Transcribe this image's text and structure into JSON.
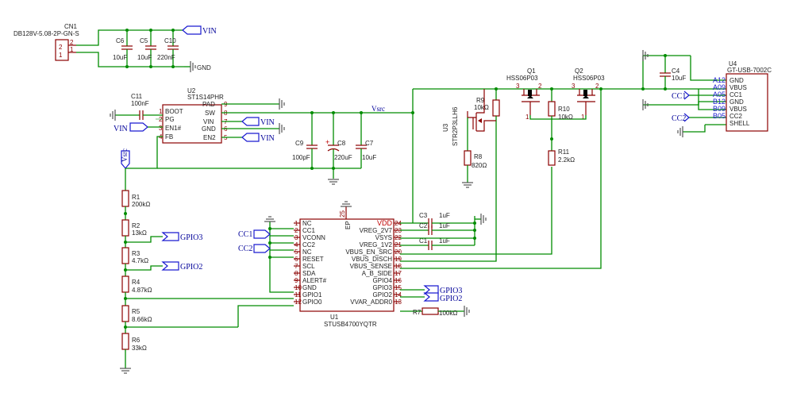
{
  "components": {
    "cn1": {
      "ref": "CN1",
      "value": "DB128V-5.08-2P-GN-S",
      "pins": [
        "2",
        "1"
      ]
    },
    "c6": {
      "ref": "C6",
      "value": "10uF"
    },
    "c5": {
      "ref": "C5",
      "value": "10uF"
    },
    "c10": {
      "ref": "C10",
      "value": "220nF"
    },
    "c11": {
      "ref": "C11",
      "value": "100nF"
    },
    "u2": {
      "ref": "U2",
      "value": "ST1S14PHR",
      "left_pins": [
        {
          "num": "1",
          "name": "BOOT"
        },
        {
          "num": "2",
          "name": "PG"
        },
        {
          "num": "3",
          "name": "EN1#"
        },
        {
          "num": "4",
          "name": "FB"
        }
      ],
      "right_pins": [
        {
          "num": "9",
          "name": "PAD"
        },
        {
          "num": "8",
          "name": "SW"
        },
        {
          "num": "7",
          "name": "VIN"
        },
        {
          "num": "6",
          "name": "GND"
        },
        {
          "num": "5",
          "name": "EN2"
        }
      ]
    },
    "c9": {
      "ref": "C9",
      "value": "100pF"
    },
    "c8": {
      "ref": "C8",
      "value": "220uF"
    },
    "c7": {
      "ref": "C7",
      "value": "10uF"
    },
    "r1": {
      "ref": "R1",
      "value": "200kΩ"
    },
    "r2": {
      "ref": "R2",
      "value": "13kΩ"
    },
    "r3": {
      "ref": "R3",
      "value": "4.7kΩ"
    },
    "r4": {
      "ref": "R4",
      "value": "4.87kΩ"
    },
    "r5": {
      "ref": "R5",
      "value": "8.66kΩ"
    },
    "r6": {
      "ref": "R6",
      "value": "33kΩ"
    },
    "u3": {
      "ref": "U3",
      "value": "STR2P3LLH6"
    },
    "r9": {
      "ref": "R9",
      "value": "10kΩ"
    },
    "r8": {
      "ref": "R8",
      "value": "820Ω"
    },
    "q1": {
      "ref": "Q1",
      "value": "HSS06P03",
      "pins": [
        "3",
        "2",
        "1"
      ]
    },
    "q2": {
      "ref": "Q2",
      "value": "HSS06P03",
      "pins": [
        "3",
        "2",
        "1"
      ]
    },
    "r10": {
      "ref": "R10",
      "value": "10kΩ"
    },
    "r11": {
      "ref": "R11",
      "value": "2.2kΩ"
    },
    "c4": {
      "ref": "C4",
      "value": "10uF"
    },
    "u4": {
      "ref": "U4",
      "value": "GT-USB-7002C",
      "pins": [
        {
          "num": "A12",
          "name": "GND"
        },
        {
          "num": "A09",
          "name": "VBUS"
        },
        {
          "num": "A05",
          "name": "CC1"
        },
        {
          "num": "B12",
          "name": "GND"
        },
        {
          "num": "B09",
          "name": "VBUS"
        },
        {
          "num": "B05",
          "name": "CC2"
        },
        {
          "num": "",
          "name": "SHELL"
        }
      ]
    },
    "c3": {
      "ref": "C3",
      "value": "1uF"
    },
    "c2": {
      "ref": "C2",
      "value": "1uF"
    },
    "c1": {
      "ref": "C1",
      "value": "1uF"
    },
    "r7": {
      "ref": "R7",
      "value": "100kΩ"
    },
    "u1": {
      "ref": "U1",
      "value": "STUSB4700YQTR",
      "top_pin": {
        "num": "25",
        "name": "EP"
      },
      "left_pins": [
        {
          "num": "1",
          "name": "NC"
        },
        {
          "num": "2",
          "name": "CC1"
        },
        {
          "num": "3",
          "name": "VCONN"
        },
        {
          "num": "4",
          "name": "CC2"
        },
        {
          "num": "5",
          "name": "NC"
        },
        {
          "num": "6",
          "name": "RESET"
        },
        {
          "num": "7",
          "name": "SCL"
        },
        {
          "num": "8",
          "name": "SDA"
        },
        {
          "num": "9",
          "name": "ALERT#"
        },
        {
          "num": "10",
          "name": "GND"
        },
        {
          "num": "11",
          "name": "GPIO1"
        },
        {
          "num": "12",
          "name": "GPIO0"
        }
      ],
      "right_pins": [
        {
          "num": "24",
          "name": "VDD"
        },
        {
          "num": "23",
          "name": "VREG_2V7"
        },
        {
          "num": "22",
          "name": "VSYS"
        },
        {
          "num": "21",
          "name": "VREG_1V2"
        },
        {
          "num": "20",
          "name": "VBUS_EN_SRC"
        },
        {
          "num": "19",
          "name": "VBUS_DISCH"
        },
        {
          "num": "18",
          "name": "VBUS_SENSE"
        },
        {
          "num": "17",
          "name": "A_B_SIDE"
        },
        {
          "num": "16",
          "name": "GPIO4"
        },
        {
          "num": "15",
          "name": "GPIO3"
        },
        {
          "num": "14",
          "name": "GPIO2"
        },
        {
          "num": "13",
          "name": "VVAR_ADDR0"
        }
      ]
    }
  },
  "nets": {
    "vin": "VIN",
    "gnd": "GND",
    "vsrc": "Vsrc",
    "cc1": "CC1",
    "cc2": "CC2",
    "gpio3": "GPIO3",
    "gpio2": "GPIO2"
  }
}
